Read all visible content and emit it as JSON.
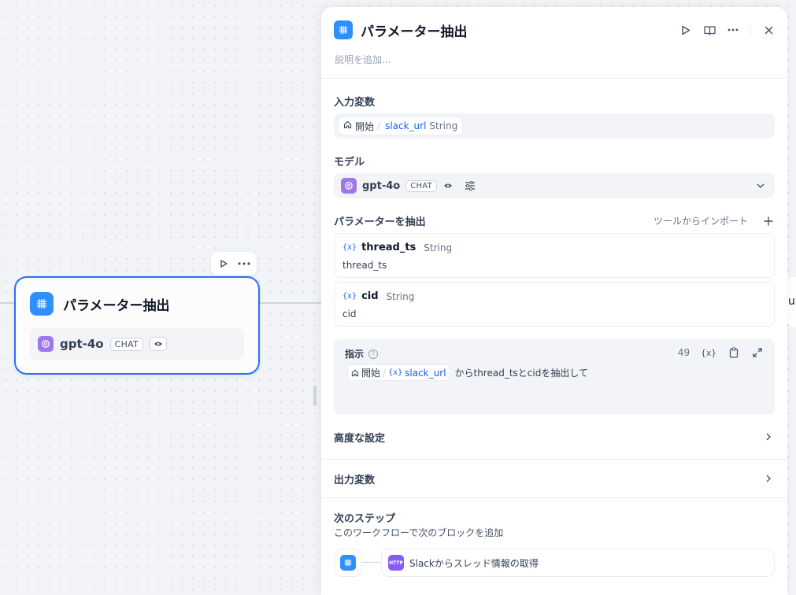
{
  "canvas": {
    "node": {
      "title": "パラメーター抽出",
      "model": "gpt-4o",
      "mode_badge": "CHAT"
    },
    "right_node_partial_text": "u"
  },
  "panel": {
    "title": "パラメーター抽出",
    "description_placeholder": "説明を追加...",
    "input_vars": {
      "label": "入力変数",
      "source": "開始",
      "separator": "/",
      "var_name": "slack_url",
      "var_type": "String"
    },
    "model": {
      "label": "モデル",
      "name": "gpt-4o",
      "mode_badge": "CHAT"
    },
    "extract": {
      "label": "パラメーターを抽出",
      "import_link": "ツールからインポート",
      "params": [
        {
          "name": "thread_ts",
          "type": "String",
          "desc": "thread_ts"
        },
        {
          "name": "cid",
          "type": "String",
          "desc": "cid"
        }
      ],
      "var_icon": "{x}"
    },
    "instruction": {
      "label": "指示",
      "count": "49",
      "var_icon": "{x}",
      "source": "開始",
      "separator": "/",
      "var_name": "slack_url",
      "text": "からthread_tsとcidを抽出して"
    },
    "advanced": {
      "label": "高度な設定"
    },
    "output_vars": {
      "label": "出力変数"
    },
    "next_step": {
      "title": "次のステップ",
      "subtitle": "このワークフローで次のブロックを追加",
      "block_badge": "HTTP",
      "block_label": "Slackからスレッド情報の取得"
    }
  },
  "colors": {
    "accent": "#2970ff",
    "node_icon": "#2e90fa",
    "openai_icon": "#9e77ed",
    "http_icon": "#875bf7",
    "link": "#155eef"
  }
}
